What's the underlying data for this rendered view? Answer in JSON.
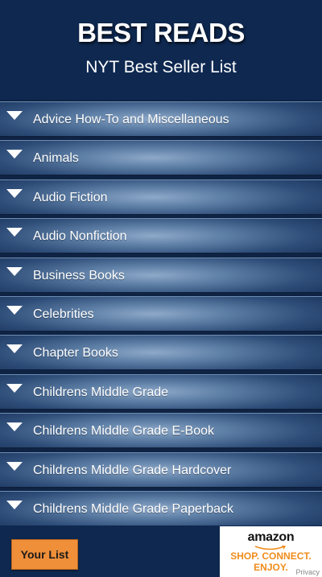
{
  "header": {
    "title": "BEST READS",
    "subtitle": "NYT Best Seller List"
  },
  "categories": [
    {
      "label": "Advice How-To and Miscellaneous"
    },
    {
      "label": "Animals"
    },
    {
      "label": "Audio Fiction"
    },
    {
      "label": "Audio Nonfiction"
    },
    {
      "label": "Business Books"
    },
    {
      "label": "Celebrities"
    },
    {
      "label": "Chapter Books"
    },
    {
      "label": "Childrens Middle Grade"
    },
    {
      "label": "Childrens Middle Grade E-Book"
    },
    {
      "label": "Childrens Middle Grade Hardcover"
    },
    {
      "label": "Childrens Middle Grade Paperback"
    }
  ],
  "footer": {
    "your_list_label": "Your List",
    "ad": {
      "logo_text": "amazon",
      "tagline_line1": "SHOP. CONNECT.",
      "tagline_line2": "ENJOY.",
      "privacy_label": "Privacy"
    }
  },
  "colors": {
    "background": "#0e2850",
    "button_accent": "#ef8f3a",
    "ad_orange": "#f08c1c"
  },
  "icons": {
    "category_arrow": "triangle-down-icon",
    "ad_smile": "amazon-smile-icon"
  }
}
